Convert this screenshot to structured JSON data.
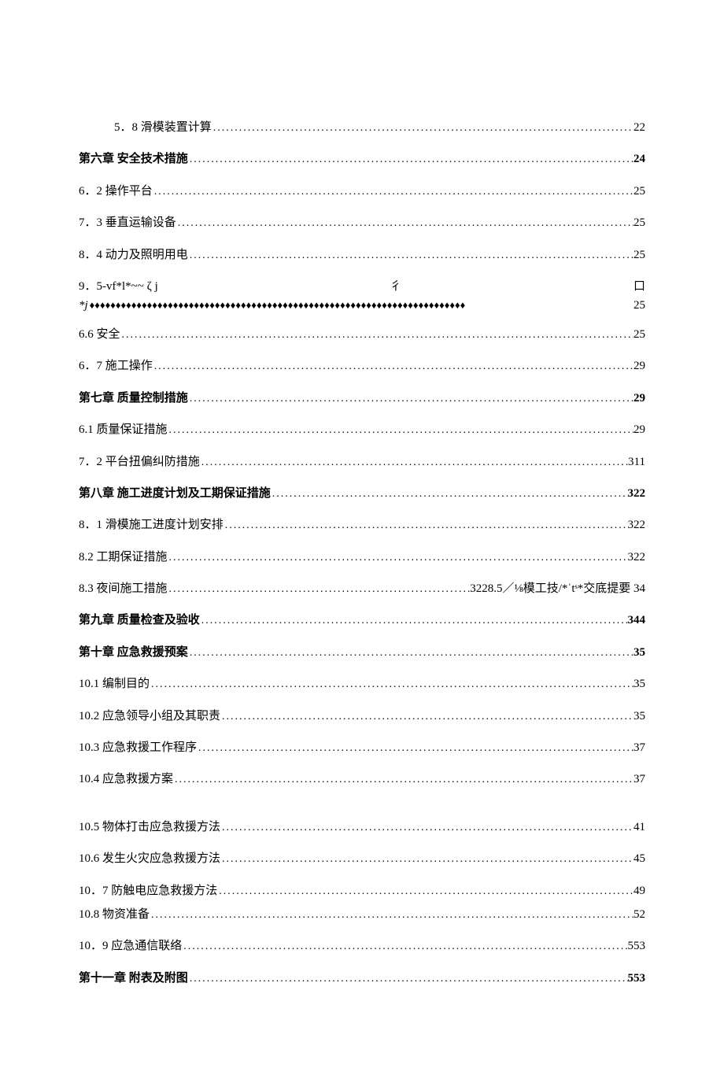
{
  "toc": [
    {
      "label": "5．8 滑模装置计算",
      "page": "22",
      "indent": true
    },
    {
      "label": "第六章 安全技术措施",
      "page": "24",
      "bold": true
    },
    {
      "label": "6．2 操作平台",
      "page": "25"
    },
    {
      "label": "7．3 垂直运输设备",
      "page": "25"
    },
    {
      "label": "8．4 动力及照明用电",
      "page": "25"
    },
    {
      "label": "9．5-vf*l*~~ ζ j",
      "middle": "彳",
      "right": "口",
      "line2prefix": "*j",
      "page": "25",
      "special": "9.5"
    },
    {
      "label": "6.6 安全",
      "page": "25"
    },
    {
      "label": "6．7 施工操作",
      "page": "29"
    },
    {
      "label": "第七章 质量控制措施",
      "page": "29",
      "bold": true
    },
    {
      "label": "6.1  质量保证措施",
      "page": "29"
    },
    {
      "label": "7．2 平台扭偏纠防措施",
      "page": "311"
    },
    {
      "label": "第八章 施工进度计划及工期保证措施",
      "page": "322",
      "bold": true
    },
    {
      "label": "8．1 滑模施工进度计划安排",
      "page": "322"
    },
    {
      "label": "8.2 工期保证措施",
      "page": "322"
    },
    {
      "label": "8.3 夜间施工措施 ",
      "middle": " 3228.5／⅛模工技/*ˈtˢ*交底提要 34",
      "special": "8.3"
    },
    {
      "label": "第九章 质量检查及验收",
      "page": "344",
      "bold": true
    },
    {
      "label": "第十章 应急救援预案",
      "page": "35",
      "bold": true
    },
    {
      "label": "10.1 编制目的",
      "page": "35"
    },
    {
      "label": "10.2 应急领导小组及其职责",
      "page": "35"
    },
    {
      "label": "10.3 应急救援工作程序",
      "page": "37"
    },
    {
      "label": "10.4 应急救援方案",
      "page": "37",
      "gap": true
    },
    {
      "label": "10.5 物体打击应急救援方法 ",
      "page": " 41"
    },
    {
      "label": "10.6 发生火灾应急救援方法 ",
      "page": " 45"
    },
    {
      "label": "10．7 防触电应急救援方法 ",
      "page": " 49"
    },
    {
      "label": "10.8 物资准备",
      "page": "52",
      "tight": true
    },
    {
      "label": "10．9 应急通信联络",
      "page": "553"
    },
    {
      "label": "第十一章 附表及附图",
      "page": "553",
      "bold": true
    }
  ],
  "leaders": {
    "dots": "........................................................................................................................................................................",
    "diamonds": "♦♦♦♦♦♦♦♦♦♦♦♦♦♦♦♦♦♦♦♦♦♦♦♦♦♦♦♦♦♦♦♦♦♦♦♦♦♦♦♦♦♦♦♦♦♦♦♦♦♦♦♦♦♦♦♦♦♦♦♦♦♦♦♦♦♦♦♦♦♦♦♦"
  }
}
